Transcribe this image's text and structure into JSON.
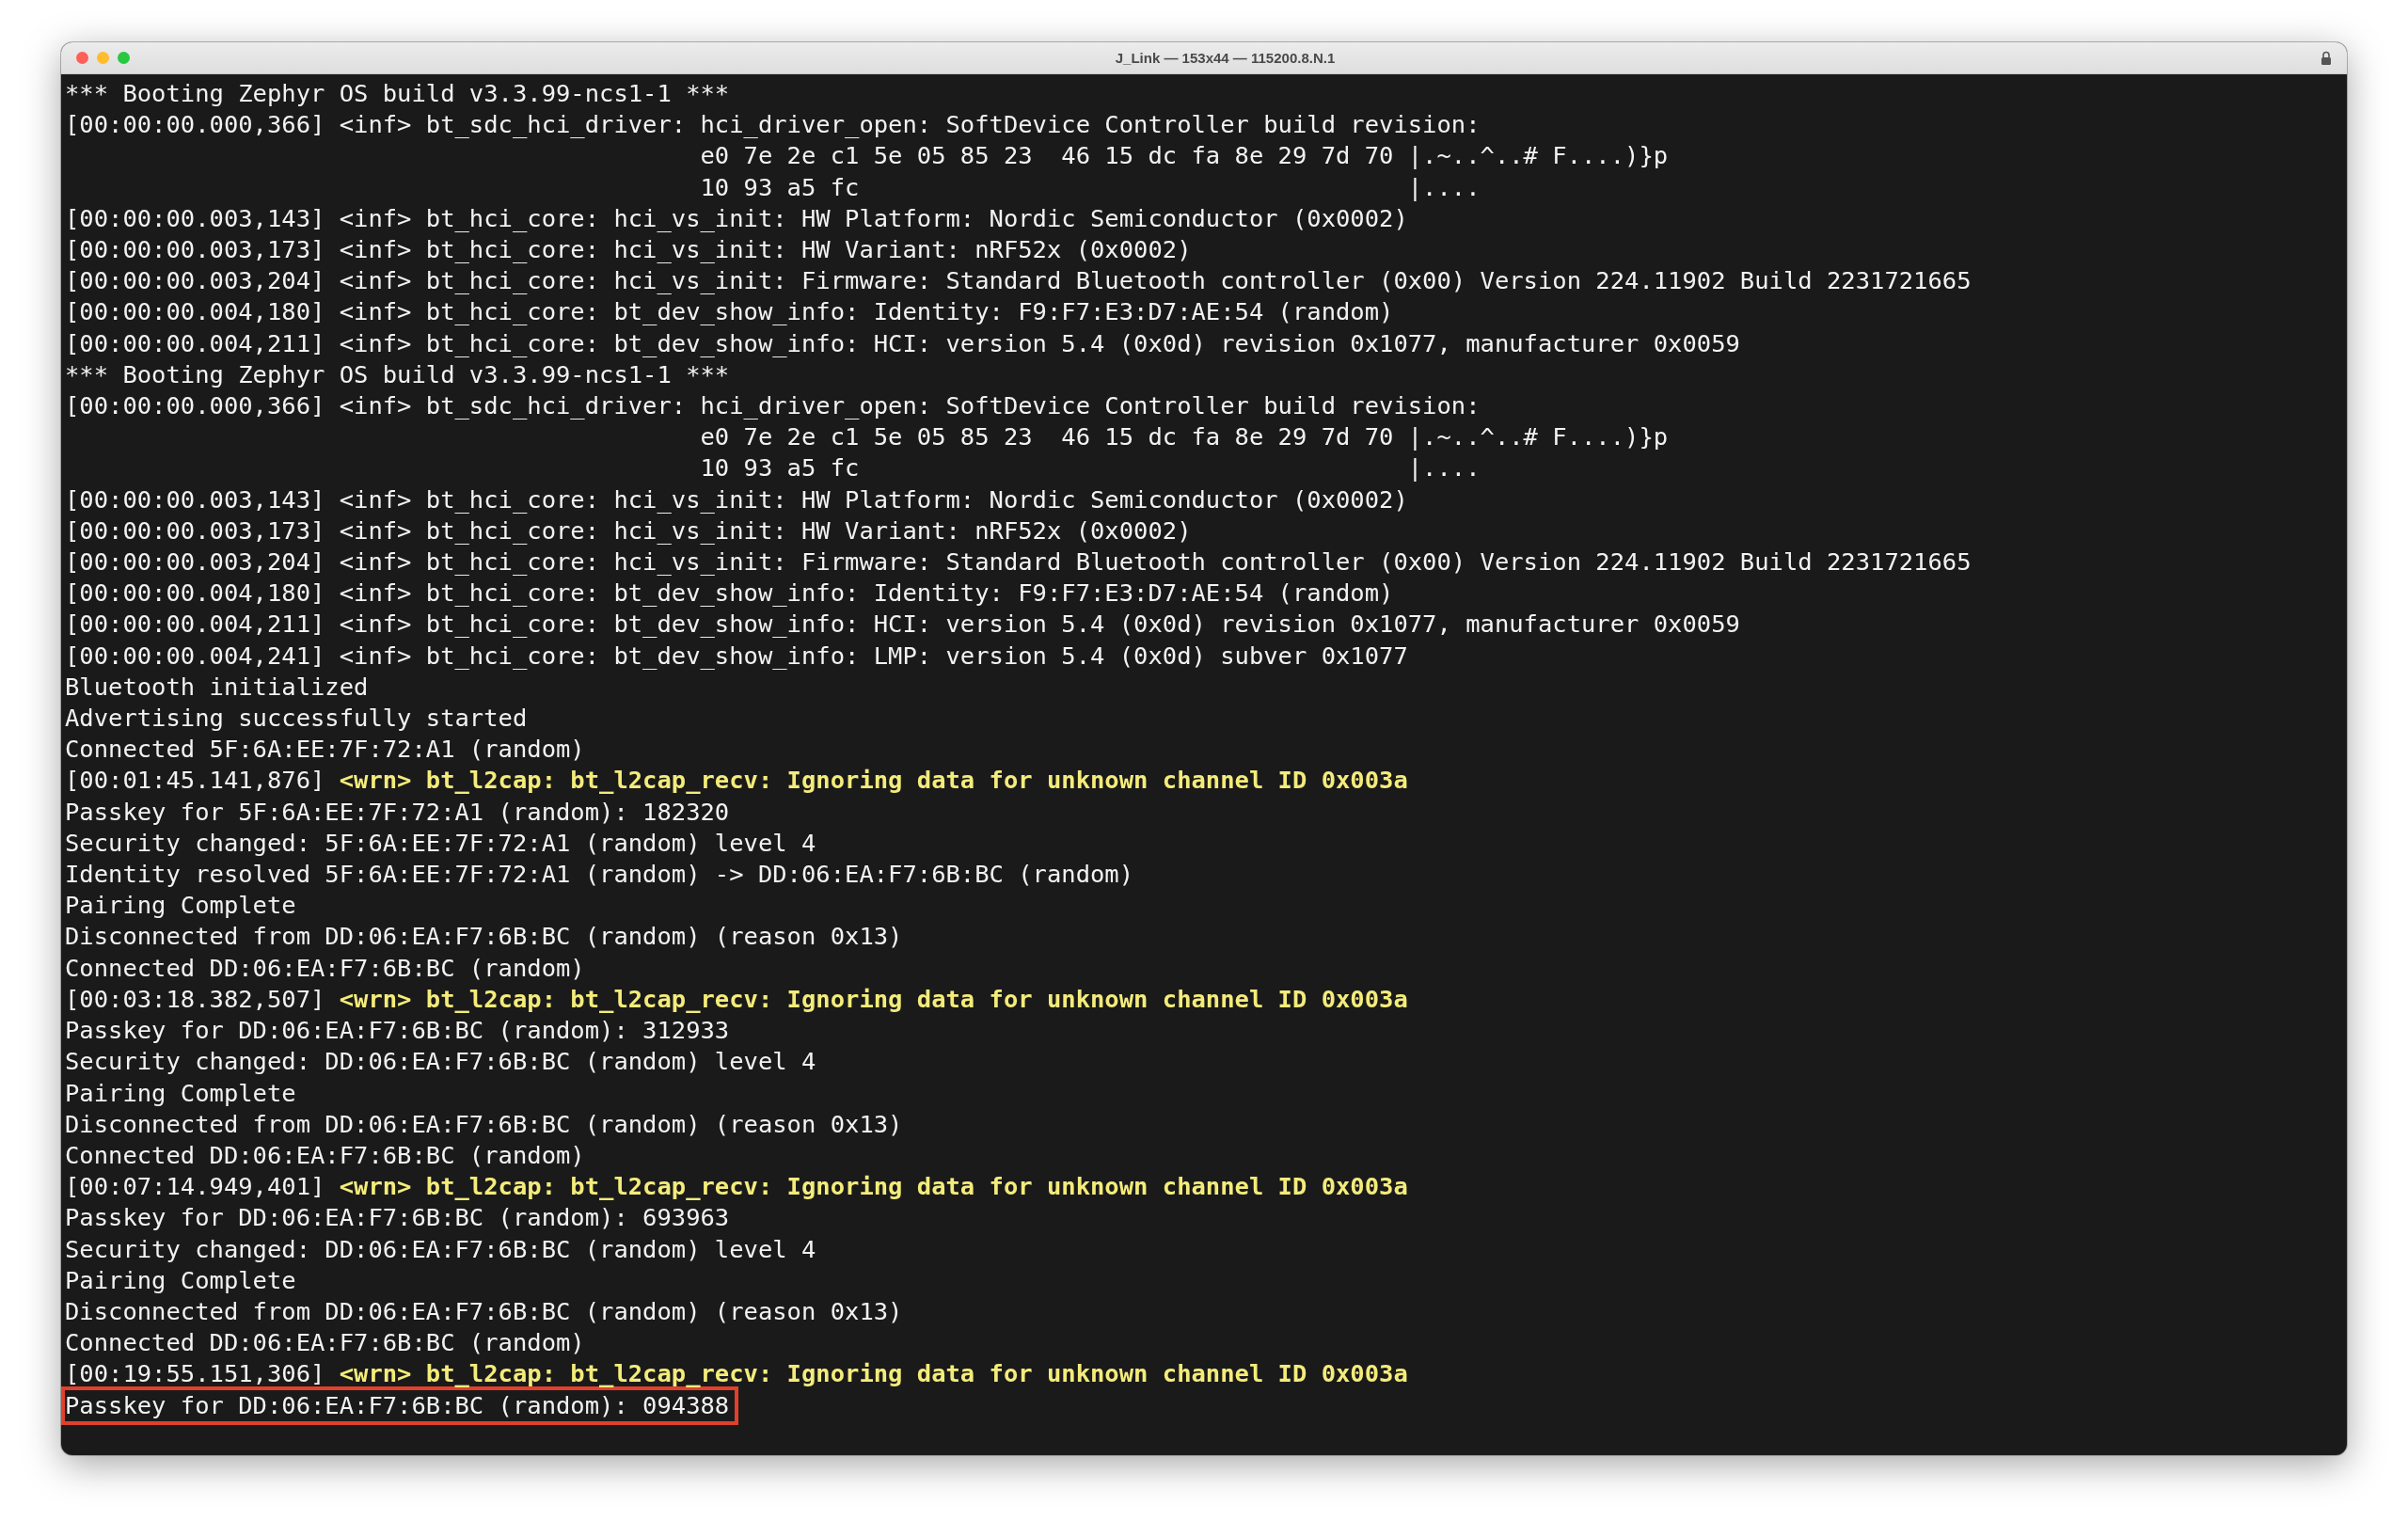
{
  "window": {
    "title": "J_Link — 153x44 — 115200.8.N.1"
  },
  "lines": [
    {
      "kind": "plain",
      "text": "*** Booting Zephyr OS build v3.3.99-ncs1-1 ***",
      "highlighted": false
    },
    {
      "kind": "plain",
      "text": "[00:00:00.000,366] <inf> bt_sdc_hci_driver: hci_driver_open: SoftDevice Controller build revision:",
      "highlighted": false
    },
    {
      "kind": "plain",
      "text": "                                            e0 7e 2e c1 5e 05 85 23  46 15 dc fa 8e 29 7d 70 |.~..^..# F....)}p",
      "highlighted": false
    },
    {
      "kind": "plain",
      "text": "                                            10 93 a5 fc                                      |....",
      "highlighted": false
    },
    {
      "kind": "plain",
      "text": "[00:00:00.003,143] <inf> bt_hci_core: hci_vs_init: HW Platform: Nordic Semiconductor (0x0002)",
      "highlighted": false
    },
    {
      "kind": "plain",
      "text": "[00:00:00.003,173] <inf> bt_hci_core: hci_vs_init: HW Variant: nRF52x (0x0002)",
      "highlighted": false
    },
    {
      "kind": "plain",
      "text": "[00:00:00.003,204] <inf> bt_hci_core: hci_vs_init: Firmware: Standard Bluetooth controller (0x00) Version 224.11902 Build 2231721665",
      "highlighted": false
    },
    {
      "kind": "plain",
      "text": "[00:00:00.004,180] <inf> bt_hci_core: bt_dev_show_info: Identity: F9:F7:E3:D7:AE:54 (random)",
      "highlighted": false
    },
    {
      "kind": "plain",
      "text": "[00:00:00.004,211] <inf> bt_hci_core: bt_dev_show_info: HCI: version 5.4 (0x0d) revision 0x1077, manufacturer 0x0059",
      "highlighted": false
    },
    {
      "kind": "plain",
      "text": "*** Booting Zephyr OS build v3.3.99-ncs1-1 ***",
      "highlighted": false
    },
    {
      "kind": "plain",
      "text": "[00:00:00.000,366] <inf> bt_sdc_hci_driver: hci_driver_open: SoftDevice Controller build revision:",
      "highlighted": false
    },
    {
      "kind": "plain",
      "text": "                                            e0 7e 2e c1 5e 05 85 23  46 15 dc fa 8e 29 7d 70 |.~..^..# F....)}p",
      "highlighted": false
    },
    {
      "kind": "plain",
      "text": "                                            10 93 a5 fc                                      |....",
      "highlighted": false
    },
    {
      "kind": "plain",
      "text": "[00:00:00.003,143] <inf> bt_hci_core: hci_vs_init: HW Platform: Nordic Semiconductor (0x0002)",
      "highlighted": false
    },
    {
      "kind": "plain",
      "text": "[00:00:00.003,173] <inf> bt_hci_core: hci_vs_init: HW Variant: nRF52x (0x0002)",
      "highlighted": false
    },
    {
      "kind": "plain",
      "text": "[00:00:00.003,204] <inf> bt_hci_core: hci_vs_init: Firmware: Standard Bluetooth controller (0x00) Version 224.11902 Build 2231721665",
      "highlighted": false
    },
    {
      "kind": "plain",
      "text": "[00:00:00.004,180] <inf> bt_hci_core: bt_dev_show_info: Identity: F9:F7:E3:D7:AE:54 (random)",
      "highlighted": false
    },
    {
      "kind": "plain",
      "text": "[00:00:00.004,211] <inf> bt_hci_core: bt_dev_show_info: HCI: version 5.4 (0x0d) revision 0x1077, manufacturer 0x0059",
      "highlighted": false
    },
    {
      "kind": "plain",
      "text": "[00:00:00.004,241] <inf> bt_hci_core: bt_dev_show_info: LMP: version 5.4 (0x0d) subver 0x1077",
      "highlighted": false
    },
    {
      "kind": "plain",
      "text": "Bluetooth initialized",
      "highlighted": false
    },
    {
      "kind": "plain",
      "text": "Advertising successfully started",
      "highlighted": false
    },
    {
      "kind": "plain",
      "text": "Connected 5F:6A:EE:7F:72:A1 (random)",
      "highlighted": false
    },
    {
      "kind": "warning",
      "timestamp": "[00:01:45.141,876]",
      "message": "<wrn> bt_l2cap: bt_l2cap_recv: Ignoring data for unknown channel ID 0x003a",
      "highlighted": false
    },
    {
      "kind": "plain",
      "text": "Passkey for 5F:6A:EE:7F:72:A1 (random): 182320",
      "highlighted": false
    },
    {
      "kind": "plain",
      "text": "Security changed: 5F:6A:EE:7F:72:A1 (random) level 4",
      "highlighted": false
    },
    {
      "kind": "plain",
      "text": "Identity resolved 5F:6A:EE:7F:72:A1 (random) -> DD:06:EA:F7:6B:BC (random)",
      "highlighted": false
    },
    {
      "kind": "plain",
      "text": "Pairing Complete",
      "highlighted": false
    },
    {
      "kind": "plain",
      "text": "Disconnected from DD:06:EA:F7:6B:BC (random) (reason 0x13)",
      "highlighted": false
    },
    {
      "kind": "plain",
      "text": "Connected DD:06:EA:F7:6B:BC (random)",
      "highlighted": false
    },
    {
      "kind": "warning",
      "timestamp": "[00:03:18.382,507]",
      "message": "<wrn> bt_l2cap: bt_l2cap_recv: Ignoring data for unknown channel ID 0x003a",
      "highlighted": false
    },
    {
      "kind": "plain",
      "text": "Passkey for DD:06:EA:F7:6B:BC (random): 312933",
      "highlighted": false
    },
    {
      "kind": "plain",
      "text": "Security changed: DD:06:EA:F7:6B:BC (random) level 4",
      "highlighted": false
    },
    {
      "kind": "plain",
      "text": "Pairing Complete",
      "highlighted": false
    },
    {
      "kind": "plain",
      "text": "Disconnected from DD:06:EA:F7:6B:BC (random) (reason 0x13)",
      "highlighted": false
    },
    {
      "kind": "plain",
      "text": "Connected DD:06:EA:F7:6B:BC (random)",
      "highlighted": false
    },
    {
      "kind": "warning",
      "timestamp": "[00:07:14.949,401]",
      "message": "<wrn> bt_l2cap: bt_l2cap_recv: Ignoring data for unknown channel ID 0x003a",
      "highlighted": false
    },
    {
      "kind": "plain",
      "text": "Passkey for DD:06:EA:F7:6B:BC (random): 693963",
      "highlighted": false
    },
    {
      "kind": "plain",
      "text": "Security changed: DD:06:EA:F7:6B:BC (random) level 4",
      "highlighted": false
    },
    {
      "kind": "plain",
      "text": "Pairing Complete",
      "highlighted": false
    },
    {
      "kind": "plain",
      "text": "Disconnected from DD:06:EA:F7:6B:BC (random) (reason 0x13)",
      "highlighted": false
    },
    {
      "kind": "plain",
      "text": "Connected DD:06:EA:F7:6B:BC (random)",
      "highlighted": false
    },
    {
      "kind": "warning",
      "timestamp": "[00:19:55.151,306]",
      "message": "<wrn> bt_l2cap: bt_l2cap_recv: Ignoring data for unknown channel ID 0x003a",
      "highlighted": false
    },
    {
      "kind": "plain",
      "text": "Passkey for DD:06:EA:F7:6B:BC (random): 094388",
      "highlighted": true
    }
  ]
}
